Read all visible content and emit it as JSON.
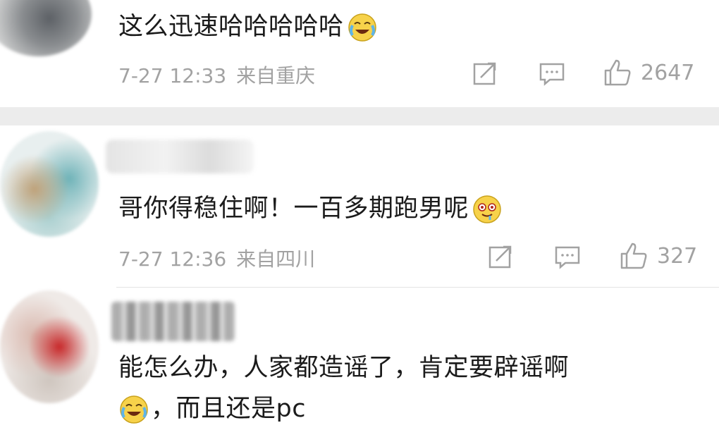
{
  "comments": [
    {
      "text": "这么迅速哈哈哈哈哈",
      "emoji": "laugh-cry-emoji",
      "date": "7-27 12:33",
      "location": "来自重庆",
      "likes": "2647"
    },
    {
      "text": "哥你得稳住啊！一百多期跑男呢",
      "emoji": "drooling-emoji",
      "date": "7-27 12:36",
      "location": "来自四川",
      "likes": "327"
    },
    {
      "text_line1": "能怎么办，人家都造谣了，肯定要辟谣啊",
      "text_line2": "，而且还是pc",
      "emoji": "laugh-cry-emoji"
    }
  ],
  "colors": {
    "text": "#1b1b1b",
    "meta": "#a2a2a2",
    "separator": "#ececec"
  }
}
